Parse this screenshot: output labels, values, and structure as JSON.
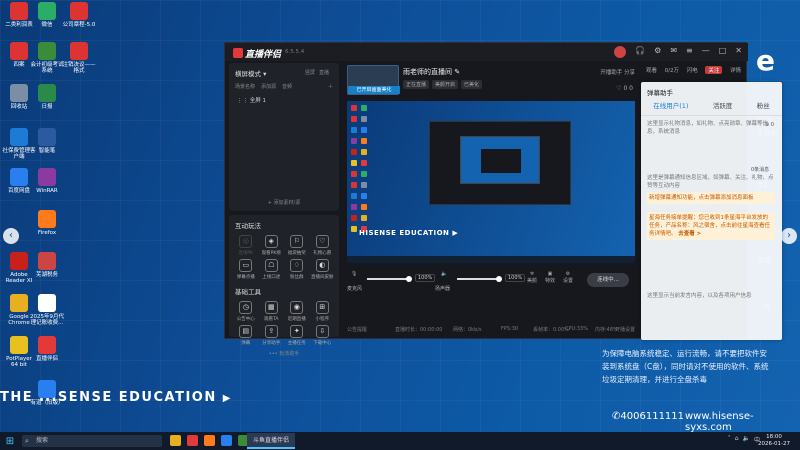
{
  "desktop": {
    "icons": [
      {
        "label": "二类利润表",
        "color": "#d33"
      },
      {
        "label": "微信",
        "color": "#2aae67"
      },
      {
        "label": "公司章程-5.0",
        "color": "#d33"
      },
      {
        "label": "四案",
        "color": "#d33"
      },
      {
        "label": "会计初级考试系统",
        "color": "#3a8b3a"
      },
      {
        "label": "注销决议——格式",
        "color": "#d33"
      },
      {
        "label": "回收站",
        "color": "#7c8ea6"
      },
      {
        "label": "日报",
        "color": "#2a8a4a"
      },
      {
        "label": "社保费管理客户端",
        "color": "#1d7bd6"
      },
      {
        "label": "智能笔",
        "color": "#2c5aa0"
      },
      {
        "label": "百度网盘",
        "color": "#2a7ff0"
      },
      {
        "label": "WinRAR",
        "color": "#8a3aa0"
      },
      {
        "label": "Firefox",
        "color": "#ff7a1a"
      },
      {
        "label": "Adobe Reader XI",
        "color": "#c8201a"
      },
      {
        "label": "芜湖税务",
        "color": "#c44"
      },
      {
        "label": "Google Chrome",
        "color": "#e8b020"
      },
      {
        "label": "2025年9月代理记账收费...",
        "color": "#fff"
      },
      {
        "label": "PotPlayer 64 bit",
        "color": "#e8c020"
      },
      {
        "label": "直播伴侣",
        "color": "#e23a3a"
      },
      {
        "label": "有道（旧版）",
        "color": "#2a7ff0"
      }
    ],
    "wallpaper": {
      "logo": "THE HISENSE EDUCATION",
      "phone": "4006111111",
      "website": "www.hisense-syxs.com",
      "paragraph": "为保障电脑系统稳定、运行流畅，请不要把软件安装到系统盘（C盘），同时请对不使用的软件、系统垃圾定期清理，并进行全盘杀毒"
    }
  },
  "app": {
    "name": "直播伴侣",
    "version": "6.5.5.4",
    "left": {
      "mode_label": "横屏模式",
      "mode_tab_1": "竖屏",
      "mode_tab_2": "直播",
      "scene_header_1": "场景名称",
      "scene_header_2": "添加源",
      "scene_header_3": "音频",
      "scene_item": "全屏 1",
      "add_source": "+ 添加素材/源",
      "interactive_title": "互动玩法",
      "interactive_tools": [
        "连线PK",
        "观看PK榜",
        "福袋抽奖",
        "礼物心愿",
        "弹幕点播",
        "上线口述",
        "粉丝群",
        "直播间皮肤"
      ],
      "basic_title": "基础工具",
      "basic_tools": [
        "公告中心",
        "观看TA",
        "近期直播",
        "小程序",
        "弹幕",
        "分享助手",
        "主播任务",
        "下载中心"
      ],
      "more_tools": "••• 玩法助手"
    },
    "center": {
      "scene_badge": "已开启画面美化",
      "room_title": "雨老师的直播间",
      "chips": [
        "正在直播",
        "美颜开启",
        "已美化"
      ],
      "header_right": "开播助手  分享",
      "likes": "0  0",
      "preview_caption": "HISENSE EDUCATION",
      "mic_label": "麦克风",
      "mic_pct": "100%",
      "speaker_label": "扬声器",
      "speaker_pct": "100%",
      "mic_level": 0.95,
      "speaker_level": 0.95,
      "btn_beauty": "美颜",
      "btn_effects": "特效",
      "btn_settings": "设置",
      "live_button": "连线中...",
      "status_items": [
        "公告提醒",
        "直播时长：00:00:00",
        "网络：0kb/s",
        "FPS:30",
        "丢帧率：0.00%",
        "CPU:33%",
        "内存:48%",
        "开播设置"
      ]
    },
    "right": {
      "tabs": [
        "观看",
        "0/2万",
        "闪电",
        "详情"
      ],
      "follow_btn": "关注"
    }
  },
  "chat": {
    "title": "弹幕助手",
    "tabs": [
      "在线用户(1)",
      "活跃度",
      "粉丝"
    ],
    "active_tab": 0,
    "messages": [
      "这里显示礼物消息，如礼物、点亮勋章、弹幕等信息，系统消息",
      "这里是弹幕通知信息区域，如弹幕、关注、礼物、点赞等互动内容",
      "这里显示直播间管理消息，公屏消息提示"
    ],
    "count_label": "0",
    "count_label_2": "0条消息",
    "highlight_1": "新增弹幕通知功能，点击弹幕添加消息面板",
    "highlight_2": "星海任务接单提醒：您已收到1条星海平台发放的任务，产品名称：风之宿舍，点击前往星海查看任务详情吧。",
    "highlight_link": "去查看 >",
    "footer_msg": "这里显示当前发言内容，以及各项用户信息"
  },
  "taskbar": {
    "search_placeholder": "搜索",
    "active_app": "斗鱼直播伴侣",
    "time": "18:00",
    "date": "2026-01-27",
    "tray": "中"
  },
  "side_nav": {
    "left": "‹",
    "right": "›"
  }
}
